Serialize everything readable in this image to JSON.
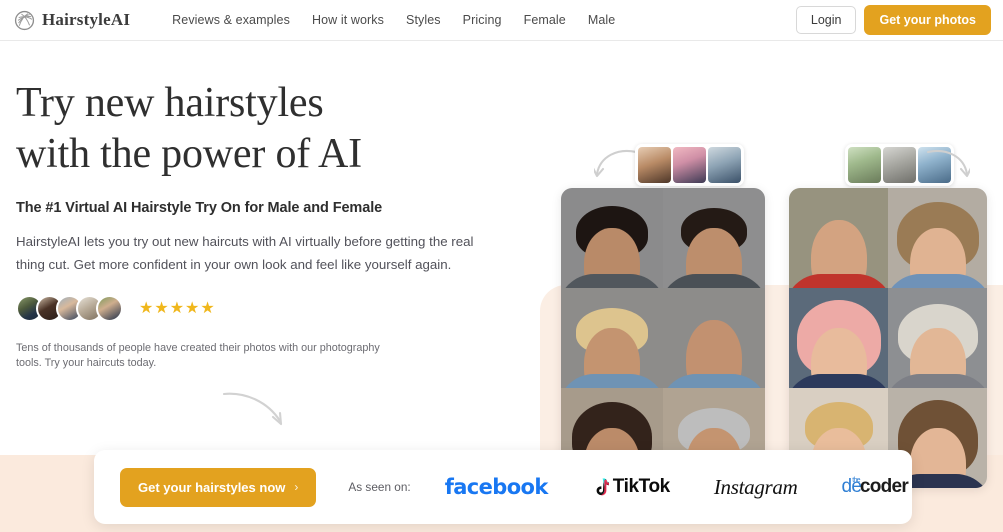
{
  "brand": {
    "name": "HairstyleAI",
    "logo_icon": "hair-circle-icon"
  },
  "nav": {
    "items": [
      {
        "label": "Reviews & examples"
      },
      {
        "label": "How it works"
      },
      {
        "label": "Styles"
      },
      {
        "label": "Pricing"
      },
      {
        "label": "Female"
      },
      {
        "label": "Male"
      }
    ]
  },
  "header_actions": {
    "login_label": "Login",
    "cta_label": "Get your photos",
    "cta_color": "#e3a21f"
  },
  "hero": {
    "title_line1": "Try new hairstyles",
    "title_line2": "with the power of AI",
    "subtitle": "The #1 Virtual AI Hairstyle Try On for Male and Female",
    "body": "HairstyleAI lets you try out new haircuts with AI virtually before getting the real thing cut. Get more confident in your own look and feel like yourself again.",
    "rating": {
      "stars": 5,
      "star_glyph": "★",
      "star_color": "#f0b71c"
    },
    "avatars_count": 5,
    "fineprint": "Tens of thousands of people have created their photos with our photography tools. Try your haircuts today.",
    "arrow_icon": "curved-arrow-down-right-icon"
  },
  "gallery": {
    "male": {
      "arrow_icon": "curved-arrow-left-icon",
      "thumbnails": [
        "male-input-1",
        "male-input-2",
        "male-input-3"
      ],
      "cells": [
        {
          "name": "male-curly-dark"
        },
        {
          "name": "male-pompadour-fade"
        },
        {
          "name": "male-blond-quiff"
        },
        {
          "name": "male-bald-shaved"
        },
        {
          "name": "male-long-wavy"
        },
        {
          "name": "male-grey-textured"
        }
      ]
    },
    "female": {
      "arrow_icon": "curved-arrow-right-icon",
      "thumbnails": [
        "female-input-1",
        "female-input-2",
        "female-input-3"
      ],
      "cells": [
        {
          "name": "female-buzzcut"
        },
        {
          "name": "female-bob-bangs"
        },
        {
          "name": "female-pink-long"
        },
        {
          "name": "female-silver-short"
        },
        {
          "name": "female-braided-updo"
        },
        {
          "name": "female-straight-ombre"
        }
      ]
    }
  },
  "cta_bar": {
    "button_label": "Get your hairstyles now",
    "button_chevron": "›",
    "as_seen_label": "As seen on:",
    "logos": [
      {
        "name": "facebook",
        "text": "facebook"
      },
      {
        "name": "tiktok",
        "text": "TikTok"
      },
      {
        "name": "instagram",
        "text": "Instagram"
      },
      {
        "name": "decoder",
        "text_de": "de",
        "text_coder": "coder",
        "text_the": "the"
      }
    ]
  }
}
